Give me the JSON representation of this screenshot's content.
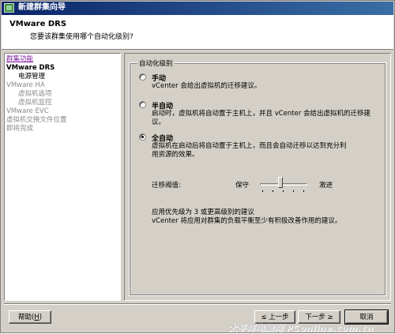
{
  "window": {
    "title": "新建群集向导"
  },
  "header": {
    "title": "VMware DRS",
    "subtitle": "您要该群集使用哪个自动化级别?"
  },
  "sidebar": {
    "items": [
      {
        "label": "群集功能",
        "state": "active"
      },
      {
        "label": "VMware DRS",
        "state": "current"
      },
      {
        "label": "电源管理",
        "state": "sub-normal"
      },
      {
        "label": "VMware HA",
        "state": "disabled"
      },
      {
        "label": "虚拟机选项",
        "state": "sub-disabled"
      },
      {
        "label": "虚拟机监控",
        "state": "sub-disabled"
      },
      {
        "label": "VMware EVC",
        "state": "disabled"
      },
      {
        "label": "虚拟机交换文件位置",
        "state": "disabled"
      },
      {
        "label": "即将完成",
        "state": "disabled"
      }
    ]
  },
  "automation": {
    "group_label": "自动化级别",
    "options": [
      {
        "title": "手动",
        "desc": "vCenter 会给出虚拟机的迁移建议。",
        "checked": false
      },
      {
        "title": "半自动",
        "desc": "启动时，虚拟机将自动置于主机上，并且 vCenter 会给出虚拟机的迁移建议。",
        "checked": false
      },
      {
        "title": "全自动",
        "desc": "虚拟机在启动后将自动置于主机上，而且会自动迁移以达到充分利用资源的效果。",
        "checked": true
      }
    ],
    "threshold": {
      "label": "迁移阈值:",
      "min_label": "保守",
      "max_label": "激进",
      "position": 3,
      "steps": 5
    },
    "priority_desc_line1": "应用优先级为 3 或更高级别的建议",
    "priority_desc_line2": "vCenter 将应用对群集的负载平衡至少有积极改善作用的建议。"
  },
  "buttons": {
    "help": {
      "label": "帮助(",
      "key": "H",
      "tail": ")"
    },
    "back": {
      "label": "≤ 上一步",
      "key": "B"
    },
    "next": {
      "label": "下一步 ≥",
      "key": "N"
    },
    "cancel": {
      "label": "取消"
    }
  },
  "watermark": "太平洋电脑网 PConline.com.cn"
}
